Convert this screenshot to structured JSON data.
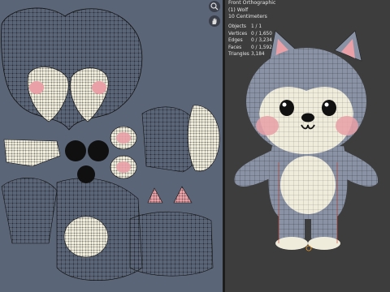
{
  "viewport": {
    "view_name": "Front Orthographic",
    "object_name": "(1) Wolf",
    "scale_label": "10 Centimeters"
  },
  "stats": [
    {
      "label": "Objects",
      "value": "1 / 1"
    },
    {
      "label": "Vertices",
      "value": "0 / 1,650"
    },
    {
      "label": "Edges",
      "value": "0 / 3,234"
    },
    {
      "label": "Faces",
      "value": "0 / 1,592"
    },
    {
      "label": "Triangles",
      "value": "3,184"
    }
  ],
  "icons": {
    "zoom": "magnifier-icon",
    "pan": "hand-icon"
  },
  "colors": {
    "uv_background": "#5a6577",
    "viewport_background": "#3d3d3d",
    "fur": "#8a93a6",
    "cream": "#f0ecdc",
    "cheek": "#e9a0a6"
  }
}
